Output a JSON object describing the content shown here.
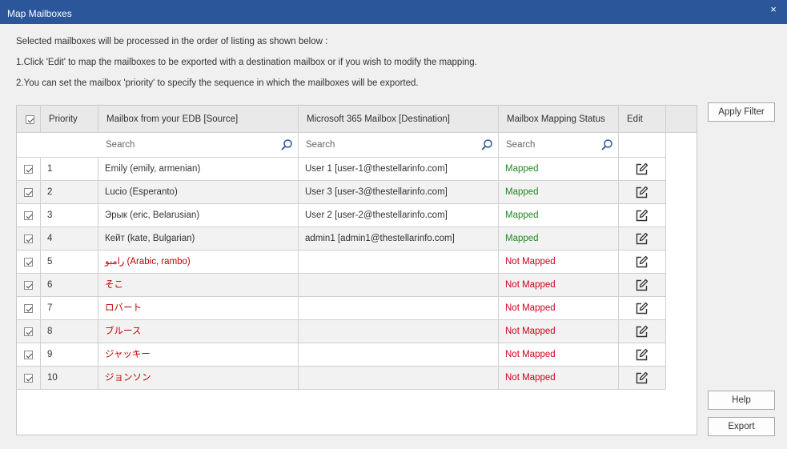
{
  "window": {
    "title": "Map Mailboxes",
    "close_glyph": "×"
  },
  "instructions": [
    "Selected mailboxes will be processed in the order of listing as shown below :",
    "1.Click  'Edit' to map the mailboxes to be exported with a destination mailbox or if you wish to modify the mapping.",
    "2.You can set the mailbox 'priority' to specify the sequence in which the mailboxes will be exported."
  ],
  "columns": {
    "priority": "Priority",
    "source": "Mailbox from your EDB [Source]",
    "destination": "Microsoft 365 Mailbox [Destination]",
    "status": "Mailbox Mapping Status",
    "edit": "Edit"
  },
  "search": {
    "placeholder": "Search"
  },
  "colors": {
    "titlebar": "#2b579a",
    "mapped": "#1f8a1f",
    "not_mapped": "#d0021b"
  },
  "rows": [
    {
      "priority": "1",
      "source": "Emily (emily, armenian)",
      "destination": "User 1 [user-1@thestellarinfo.com]",
      "status": "Mapped",
      "mapped": true,
      "checked": true
    },
    {
      "priority": "2",
      "source": "Lucio (Esperanto)",
      "destination": "User  3 [user-3@thestellarinfo.com]",
      "status": "Mapped",
      "mapped": true,
      "checked": true
    },
    {
      "priority": "3",
      "source": "Эрык (eric, Belarusian)",
      "destination": "User 2 [user-2@thestellarinfo.com]",
      "status": "Mapped",
      "mapped": true,
      "checked": true
    },
    {
      "priority": "4",
      "source": "Кейт (kate, Bulgarian)",
      "destination": "admin1 [admin1@thestellarinfo.com]",
      "status": "Mapped",
      "mapped": true,
      "checked": true
    },
    {
      "priority": "5",
      "source": "رامبو (Arabic, rambo)",
      "destination": "",
      "status": "Not Mapped",
      "mapped": false,
      "checked": true
    },
    {
      "priority": "6",
      "source": "そこ",
      "destination": "",
      "status": "Not Mapped",
      "mapped": false,
      "checked": true
    },
    {
      "priority": "7",
      "source": "ロバート",
      "destination": "",
      "status": "Not Mapped",
      "mapped": false,
      "checked": true
    },
    {
      "priority": "8",
      "source": "ブルース",
      "destination": "",
      "status": "Not Mapped",
      "mapped": false,
      "checked": true
    },
    {
      "priority": "9",
      "source": "ジャッキー",
      "destination": "",
      "status": "Not Mapped",
      "mapped": false,
      "checked": true
    },
    {
      "priority": "10",
      "source": "ジョンソン",
      "destination": "",
      "status": "Not Mapped",
      "mapped": false,
      "checked": true
    }
  ],
  "buttons": {
    "apply_filter": "Apply Filter",
    "help": "Help",
    "export": "Export"
  }
}
